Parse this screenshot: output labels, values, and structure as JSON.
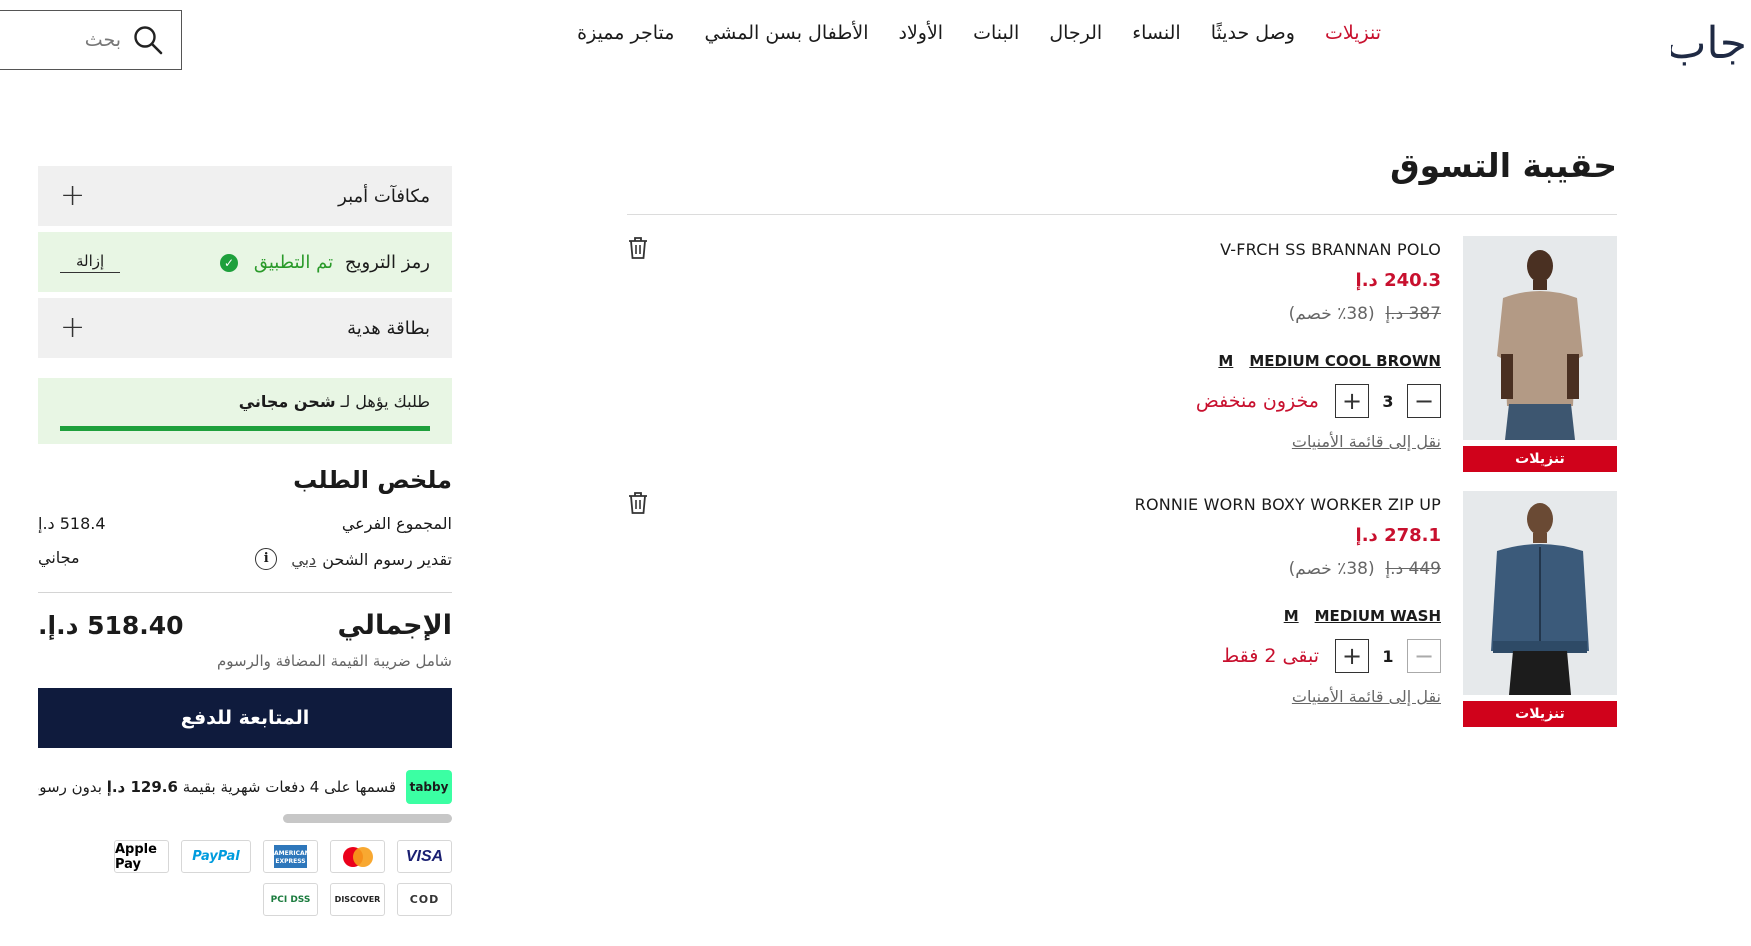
{
  "header": {
    "logo_text": "جاب",
    "nav": [
      {
        "label": "تنزيلات",
        "sale": true
      },
      {
        "label": "وصل حديثًا"
      },
      {
        "label": "النساء"
      },
      {
        "label": "الرجال"
      },
      {
        "label": "البنات"
      },
      {
        "label": "الأولاد"
      },
      {
        "label": "الأطفال بسن المشي"
      },
      {
        "label": "متاجر مميزة"
      }
    ],
    "search_placeholder": "بحث"
  },
  "bag": {
    "title": "حقيبة التسوق",
    "items": [
      {
        "name": "V-FRCH SS BRANNAN POLO",
        "price": "240.3 د.إ",
        "old_price": "387 د.إ",
        "discount": "(38٪ خصم)",
        "size": "M",
        "color": "MEDIUM COOL BROWN",
        "qty": "3",
        "stock": "مخزون منخفض",
        "wishlist": "نقل إلى قائمة الأمنيات",
        "badge": "تنزيلات",
        "minus_dim": false
      },
      {
        "name": "RONNIE WORN BOXY WORKER ZIP UP",
        "price": "278.1 د.إ",
        "old_price": "449 د.إ",
        "discount": "(38٪ خصم)",
        "size": "M",
        "color": "MEDIUM WASH",
        "qty": "1",
        "stock": "تبقى 2 فقط",
        "wishlist": "نقل إلى قائمة الأمنيات",
        "badge": "تنزيلات",
        "minus_dim": true
      }
    ]
  },
  "summary": {
    "rewards_label": "مكافآت أمبر",
    "promo_label": "رمز الترويج",
    "promo_applied": "تم التطبيق",
    "promo_remove": "إزالة",
    "gift_label": "بطاقة هدية",
    "free_ship_prefix": "طلبك يؤهل لـ ",
    "free_ship_bold": "شحن مجاني",
    "title": "ملخص الطلب",
    "subtotal_label": "المجموع الفرعي",
    "subtotal_value": "518.4 د.إ",
    "shipping_label": "تقدير رسوم الشحن",
    "shipping_city": "دبي",
    "shipping_value": "مجاني",
    "total_label": "الإجمالي",
    "total_value": "518.40 د.إ.",
    "vat_note": "شامل ضريبة القيمة المضافة والرسوم",
    "checkout_label": "المتابعة للدفع",
    "tabby_logo": "tabby",
    "tabby_text_a": "قسمها على 4 دفعات شهرية بقيمة ",
    "tabby_amount": "129.6 د.إ",
    "tabby_text_b": " بدون رسوم",
    "payment_methods": [
      "VISA",
      "Mastercard",
      "AMERICAN EXPRESS",
      "PayPal",
      "Apple Pay",
      "COD",
      "DISCOVER",
      "PCI DSS"
    ]
  }
}
